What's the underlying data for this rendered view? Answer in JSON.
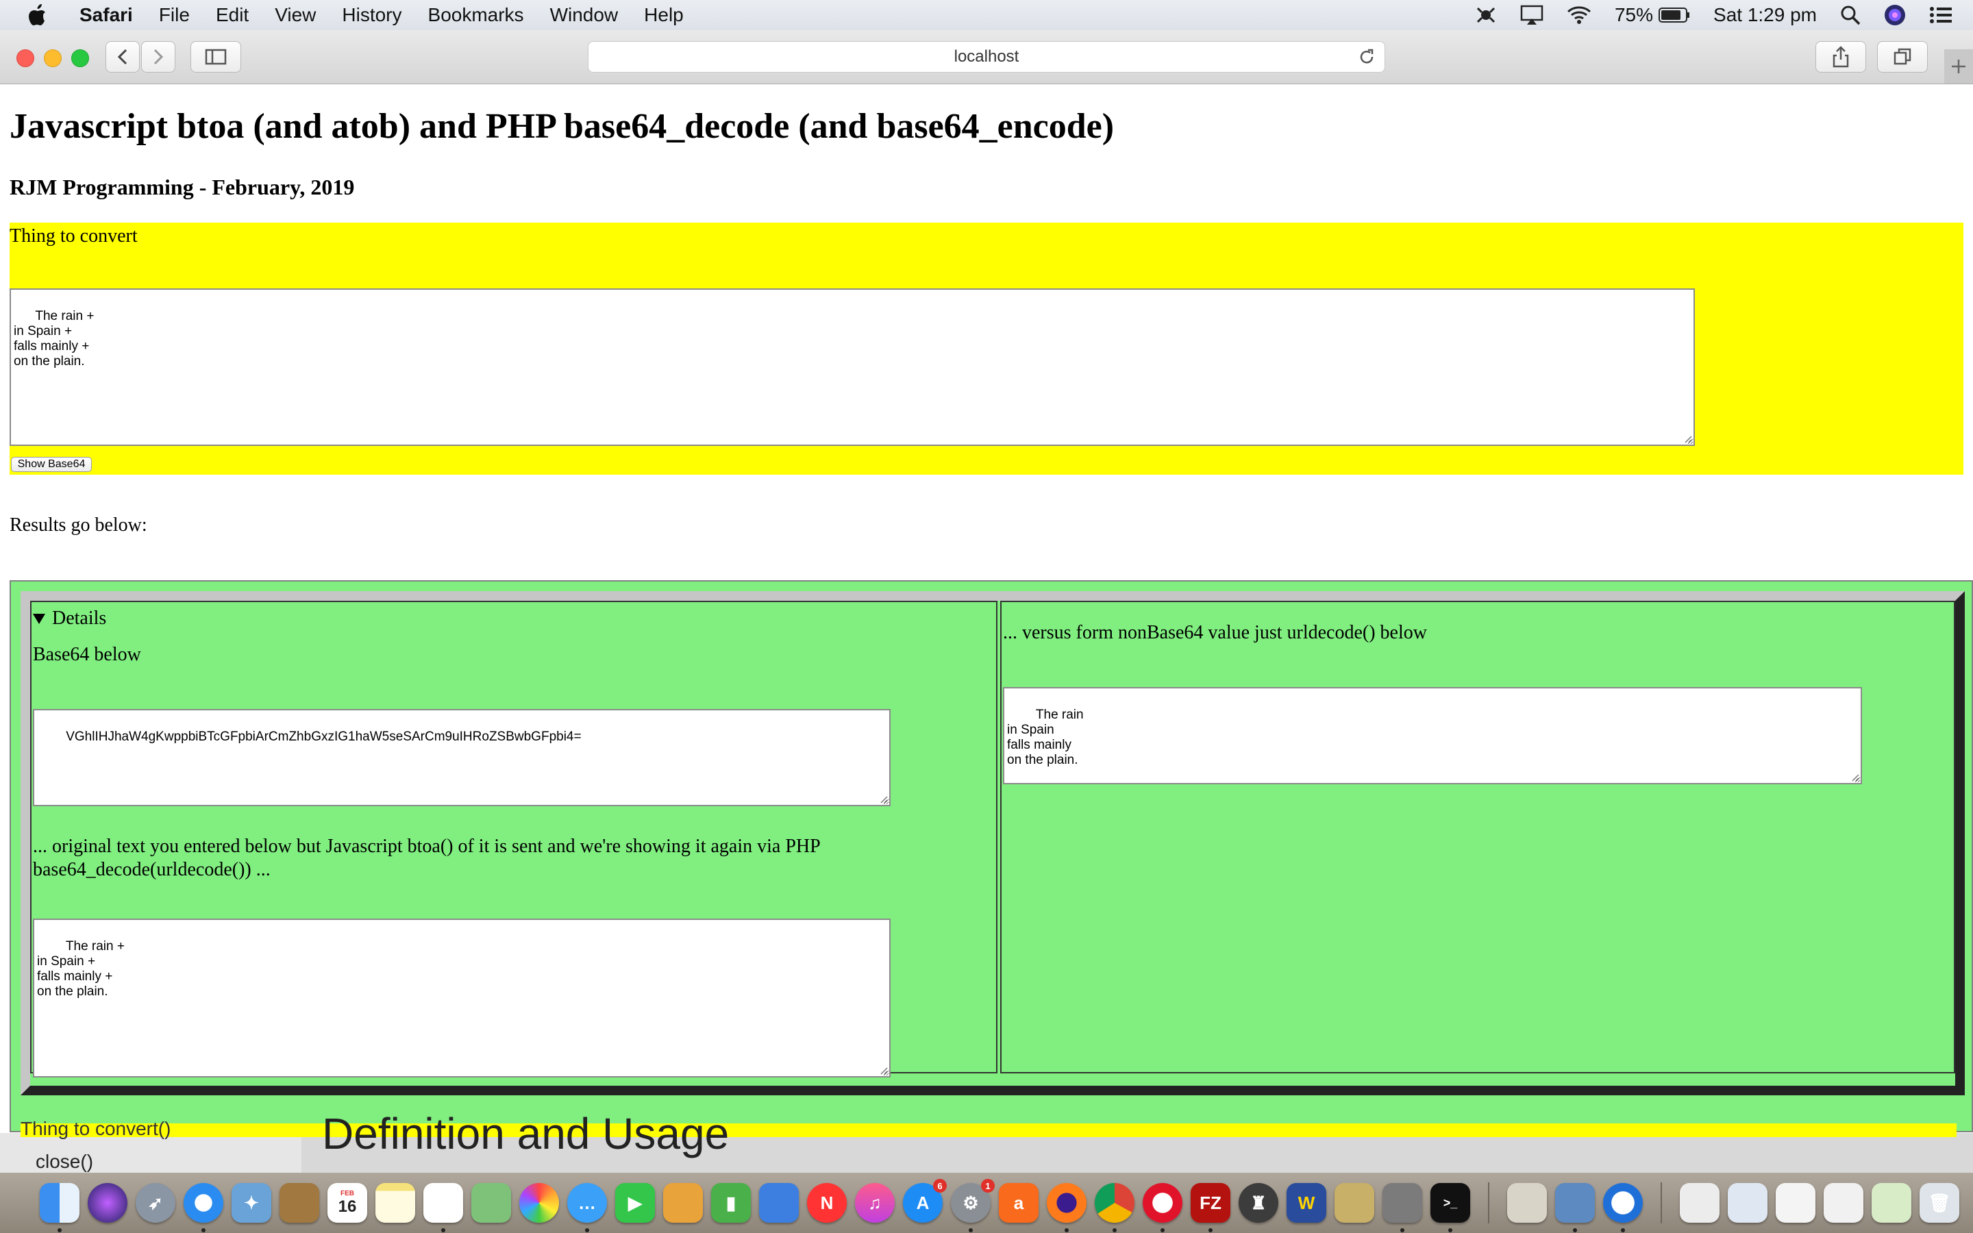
{
  "menubar": {
    "app_name": "Safari",
    "items": [
      "File",
      "Edit",
      "View",
      "History",
      "Bookmarks",
      "Window",
      "Help"
    ],
    "battery_percent": "75%",
    "clock": "Sat 1:29 pm"
  },
  "browser": {
    "url": "localhost"
  },
  "page": {
    "title": "Javascript btoa (and atob) and PHP base64_decode (and base64_encode)",
    "subtitle": "RJM Programming - February, 2019",
    "form": {
      "label": "Thing to convert",
      "textarea_value": "The rain +\nin Spain +\nfalls mainly +\non the plain.",
      "button_label": "Show Base64"
    },
    "results_label": "Results go below:",
    "left_panel": {
      "details_summary": "Details",
      "base64_label": "Base64 below",
      "base64_value": "VGhlIHJhaW4gKwppbiBTcGFpbiArCmZhbGxzIG1haW5seSArCm9uIHRoZSBwbGFpbi4=",
      "original_label": "... original text you entered below but Javascript btoa() of it is sent and we're showing it again via PHP base64_decode(urldecode()) ...",
      "original_value": "The rain +\nin Spain +\nfalls mainly +\non the plain."
    },
    "right_panel": {
      "label": "... versus form nonBase64 value just urldecode() below",
      "value": "The rain\nin Spain\nfalls mainly\non the plain."
    }
  },
  "background_window": {
    "text_top": "Thing to convert()",
    "text_close": "close()",
    "heading": "Definition and Usage"
  },
  "dock": {
    "calendar_month": "FEB",
    "calendar_day": "16",
    "app_store_badge": "6",
    "sys_prefs_badge": "1"
  }
}
